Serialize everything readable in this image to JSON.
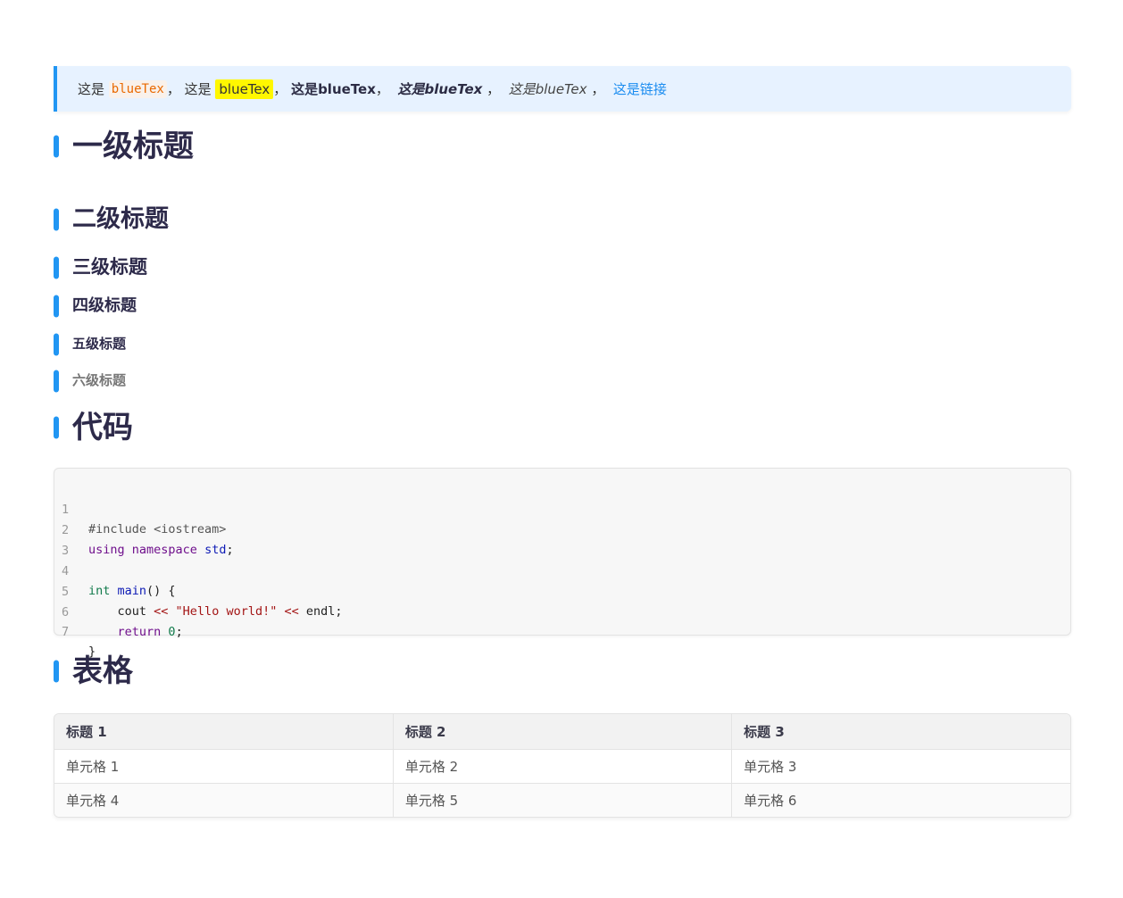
{
  "quote": {
    "t1": "这是",
    "code": "blueTex",
    "sep1": "， 这是",
    "mark": "blueTex",
    "sep2": "，",
    "bold": "这是blueTex",
    "sep3": "，",
    "bold_italic": "这是blueTex",
    "sep4": "，",
    "italic": "这是blueTex",
    "sep5": "，",
    "link": "这是链接"
  },
  "headings": {
    "h1": "一级标题",
    "h2": "二级标题",
    "h3": "三级标题",
    "h4": "四级标题",
    "h5": "五级标题",
    "h6": "六级标题",
    "code": "代码",
    "table": "表格"
  },
  "code": {
    "line_numbers": [
      "1",
      "2",
      "3",
      "4",
      "5",
      "6",
      "7"
    ],
    "l1": "#include <iostream>",
    "l2_kw1": "using",
    "l2_kw2": "namespace",
    "l2_ns": "std",
    "l2_end": ";",
    "l4_type": "int",
    "l4_fn": "main",
    "l4_rest": "() {",
    "l5_indent": "    cout ",
    "l5_op1": "<<",
    "l5_str": " \"Hello world!\" ",
    "l5_op2": "<<",
    "l5_rest": " endl;",
    "l6_indent": "    ",
    "l6_kw": "return",
    "l6_num": " 0",
    "l6_end": ";",
    "l7": "}"
  },
  "table": {
    "headers": [
      "标题 1",
      "标题 2",
      "标题 3"
    ],
    "rows": [
      [
        "单元格 1",
        "单元格 2",
        "单元格 3"
      ],
      [
        "单元格 4",
        "单元格 5",
        "单元格 6"
      ]
    ]
  },
  "colors": {
    "accent": "#2196f3",
    "quote_bg": "#e7f2ff",
    "highlight": "#fff700",
    "inline_code": "#e96900",
    "link": "#1a8cf0"
  }
}
